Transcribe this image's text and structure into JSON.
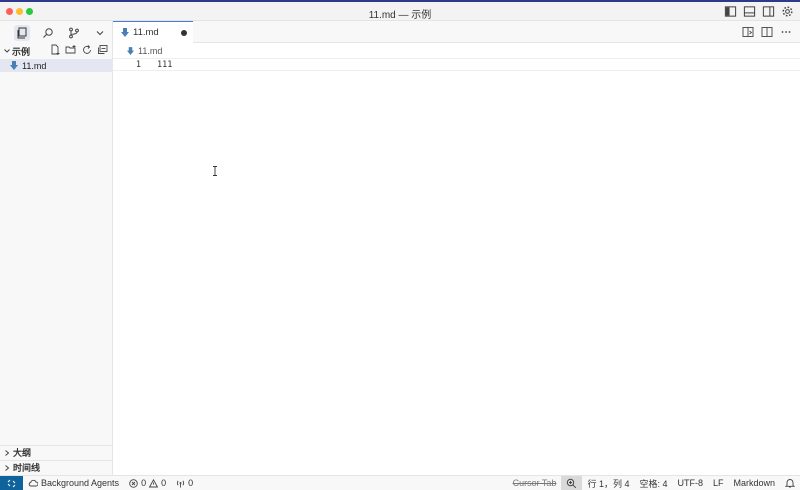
{
  "window": {
    "title": "11.md — 示例"
  },
  "sidebar": {
    "explorer_title": "示例",
    "files": [
      {
        "name": "11.md"
      }
    ],
    "outline_label": "大纲",
    "timeline_label": "时间线"
  },
  "editor": {
    "tab_label": "11.md",
    "breadcrumb": "11.md",
    "lines": [
      {
        "number": "1",
        "text": "111"
      }
    ]
  },
  "statusbar": {
    "background_agents": "Background Agents",
    "errors": "0",
    "warnings": "0",
    "ports": "0",
    "cursor_tab": "Cursor Tab",
    "position": "行 1，列 4",
    "spaces": "空格: 4",
    "encoding": "UTF-8",
    "eol": "LF",
    "language": "Markdown"
  },
  "colors": {
    "accent": "#0e639c",
    "tab_border": "#4a7bd6",
    "markdown_icon": "#4a7fb5"
  }
}
